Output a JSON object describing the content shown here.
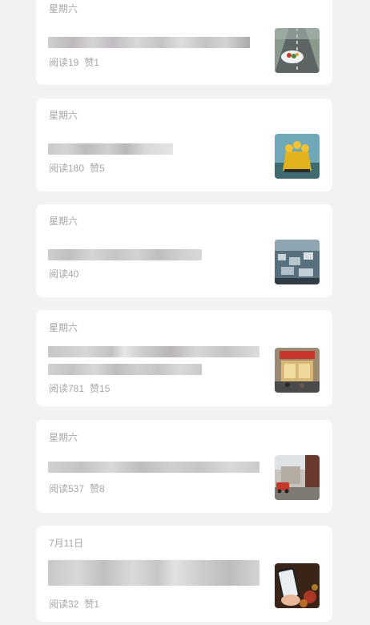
{
  "articles": [
    {
      "date": "星期六",
      "reads": "阅读19",
      "likes": "赞1",
      "thumb_icon": "road-food-thumbnail-icon"
    },
    {
      "date": "星期六",
      "reads": "阅读180",
      "likes": "赞5",
      "thumb_icon": "yellow-figures-thumbnail-icon"
    },
    {
      "date": "星期六",
      "reads": "阅读40",
      "likes": "",
      "thumb_icon": "cityscape-thumbnail-icon"
    },
    {
      "date": "星期六",
      "reads": "阅读781",
      "likes": "赞15",
      "thumb_icon": "storefront-thumbnail-icon"
    },
    {
      "date": "星期六",
      "reads": "阅读537",
      "likes": "赞8",
      "thumb_icon": "street-scene-thumbnail-icon"
    },
    {
      "date": "7月11日",
      "reads": "阅读32",
      "likes": "赞1",
      "thumb_icon": "phone-in-hand-thumbnail-icon"
    }
  ]
}
